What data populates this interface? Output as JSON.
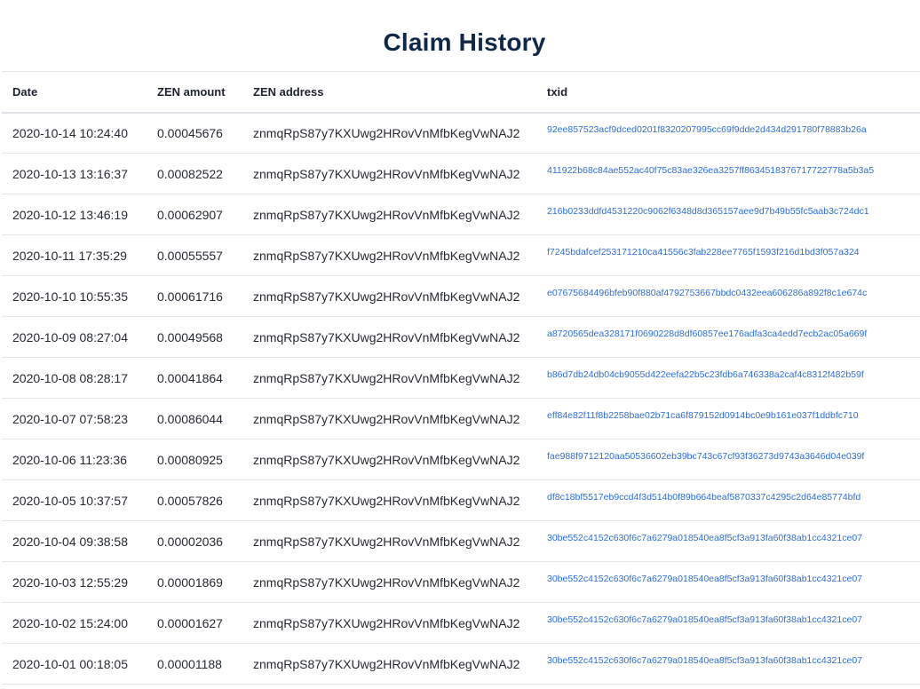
{
  "page": {
    "title": "Claim History"
  },
  "table": {
    "headers": {
      "date": "Date",
      "amount": "ZEN amount",
      "address": "ZEN address",
      "txid": "txid"
    },
    "rows": [
      {
        "date": "2020-10-14 10:24:40",
        "amount": "0.00045676",
        "address": "znmqRpS87y7KXUwg2HRovVnMfbKegVwNAJ2",
        "txid": "92ee857523acf9dced0201f8320207995cc69f9dde2d434d291780f78883b26a"
      },
      {
        "date": "2020-10-13 13:16:37",
        "amount": "0.00082522",
        "address": "znmqRpS87y7KXUwg2HRovVnMfbKegVwNAJ2",
        "txid": "411922b68c84ae552ac40f75c83ae326ea3257ff8634518376717722778a5b3a5"
      },
      {
        "date": "2020-10-12 13:46:19",
        "amount": "0.00062907",
        "address": "znmqRpS87y7KXUwg2HRovVnMfbKegVwNAJ2",
        "txid": "216b0233ddfd4531220c9062f6348d8d365157aee9d7b49b55fc5aab3c724dc1"
      },
      {
        "date": "2020-10-11 17:35:29",
        "amount": "0.00055557",
        "address": "znmqRpS87y7KXUwg2HRovVnMfbKegVwNAJ2",
        "txid": "f7245bdafcef253171210ca41556c3fab228ee7765f1593f216d1bd3f057a324"
      },
      {
        "date": "2020-10-10 10:55:35",
        "amount": "0.00061716",
        "address": "znmqRpS87y7KXUwg2HRovVnMfbKegVwNAJ2",
        "txid": "e07675684496bfeb90f880af4792753667bbdc0432eea606286a892f8c1e674c"
      },
      {
        "date": "2020-10-09 08:27:04",
        "amount": "0.00049568",
        "address": "znmqRpS87y7KXUwg2HRovVnMfbKegVwNAJ2",
        "txid": "a8720565dea328171f0690228d8df60857ee176adfa3ca4edd7ecb2ac05a669f"
      },
      {
        "date": "2020-10-08 08:28:17",
        "amount": "0.00041864",
        "address": "znmqRpS87y7KXUwg2HRovVnMfbKegVwNAJ2",
        "txid": "b86d7db24db04cb9055d422eefa22b5c23fdb6a746338a2caf4c8312f482b59f"
      },
      {
        "date": "2020-10-07 07:58:23",
        "amount": "0.00086044",
        "address": "znmqRpS87y7KXUwg2HRovVnMfbKegVwNAJ2",
        "txid": "eff84e82f11f8b2258bae02b71ca6f879152d0914bc0e9b161e037f1ddbfc710"
      },
      {
        "date": "2020-10-06 11:23:36",
        "amount": "0.00080925",
        "address": "znmqRpS87y7KXUwg2HRovVnMfbKegVwNAJ2",
        "txid": "fae988f9712120aa50536602eb39bc743c67cf93f36273d9743a3646d04e039f"
      },
      {
        "date": "2020-10-05 10:37:57",
        "amount": "0.00057826",
        "address": "znmqRpS87y7KXUwg2HRovVnMfbKegVwNAJ2",
        "txid": "df8c18bf5517eb9ccd4f3d514b0f89b664beaf5870337c4295c2d64e85774bfd"
      },
      {
        "date": "2020-10-04 09:38:58",
        "amount": "0.00002036",
        "address": "znmqRpS87y7KXUwg2HRovVnMfbKegVwNAJ2",
        "txid": "30be552c4152c630f6c7a6279a018540ea8f5cf3a913fa60f38ab1cc4321ce07"
      },
      {
        "date": "2020-10-03 12:55:29",
        "amount": "0.00001869",
        "address": "znmqRpS87y7KXUwg2HRovVnMfbKegVwNAJ2",
        "txid": "30be552c4152c630f6c7a6279a018540ea8f5cf3a913fa60f38ab1cc4321ce07"
      },
      {
        "date": "2020-10-02 15:24:00",
        "amount": "0.00001627",
        "address": "znmqRpS87y7KXUwg2HRovVnMfbKegVwNAJ2",
        "txid": "30be552c4152c630f6c7a6279a018540ea8f5cf3a913fa60f38ab1cc4321ce07"
      },
      {
        "date": "2020-10-01 00:18:05",
        "amount": "0.00001188",
        "address": "znmqRpS87y7KXUwg2HRovVnMfbKegVwNAJ2",
        "txid": "30be552c4152c630f6c7a6279a018540ea8f5cf3a913fa60f38ab1cc4321ce07"
      }
    ]
  },
  "colors": {
    "title": "#0f2748",
    "link": "#2f6fd6",
    "border": "#e4e6ea"
  }
}
